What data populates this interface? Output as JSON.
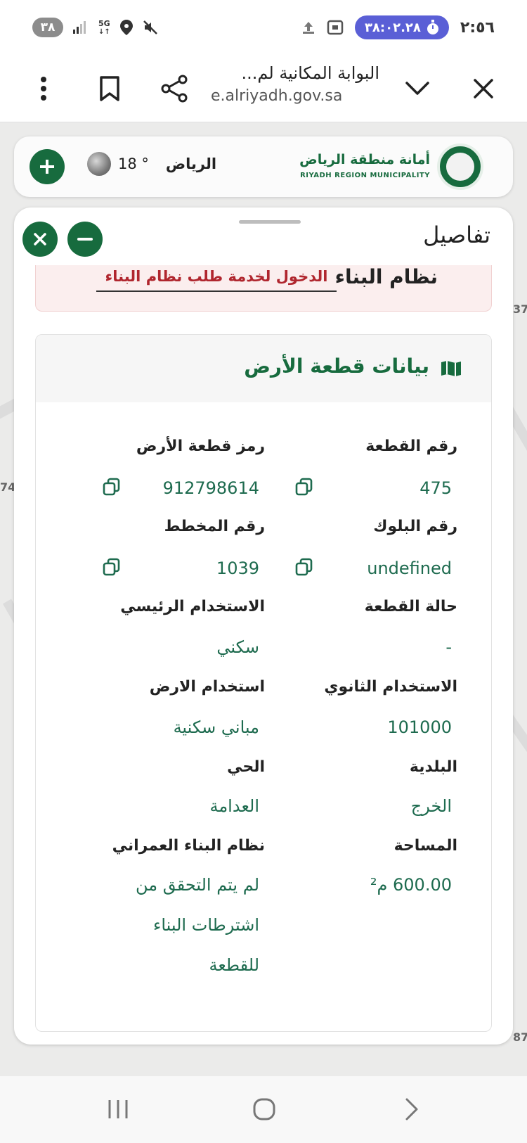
{
  "status_bar": {
    "battery": "٣٨",
    "network": "5G",
    "clock": "٢:٥٦",
    "timer": "٣٨:٠٢.٢٨"
  },
  "browser": {
    "title": "البوابة المكانية لم...",
    "url": "e.alriyadh.gov.sa",
    "icons": [
      "close-icon",
      "chevron-down-icon",
      "share-icon",
      "bookmark-icon",
      "more-vert-icon"
    ]
  },
  "map_edge_numbers": [
    "37",
    "74",
    "87"
  ],
  "header": {
    "city": "الرياض",
    "temperature": "18 °",
    "municipality_ar": "أمانة منطقة الرياض",
    "municipality_en": "RIYADH REGION MUNICIPALITY",
    "brand_color": "#176b3e"
  },
  "details": {
    "title": "تفاصيل",
    "building_system": {
      "label": "نظام البناء",
      "link": "الدخول لخدمة طلب نظام البناء",
      "link_color": "#b0262e"
    },
    "land_section": {
      "title": "بيانات قطعة الأرض",
      "fields": [
        {
          "label": "رقم القطعة",
          "value": "475",
          "copyable": true
        },
        {
          "label": "رمز قطعة الأرض",
          "value": "912798614",
          "copyable": true
        },
        {
          "label": "رقم البلوك",
          "value": "undefined",
          "copyable": true
        },
        {
          "label": "رقم المخطط",
          "value": "1039",
          "copyable": true
        },
        {
          "label": "حالة القطعة",
          "value": "-"
        },
        {
          "label": "الاستخدام الرئيسي",
          "value": "سكني"
        },
        {
          "label": "الاستخدام الثانوي",
          "value": "101000"
        },
        {
          "label": "استخدام الارض",
          "value": "مباني سكنية"
        },
        {
          "label": "البلدية",
          "value": "الخرج"
        },
        {
          "label": "الحي",
          "value": "العدامة"
        },
        {
          "label": "المساحة",
          "value": "600.00 م²"
        },
        {
          "label": "نظام البناء العمراني",
          "value_lines": [
            "لم يتم التحقق من",
            "اشترطات البناء",
            "للقطعة"
          ]
        }
      ]
    }
  },
  "nav_bar": {
    "icons": [
      "recent-apps-icon",
      "home-icon",
      "back-icon"
    ]
  }
}
